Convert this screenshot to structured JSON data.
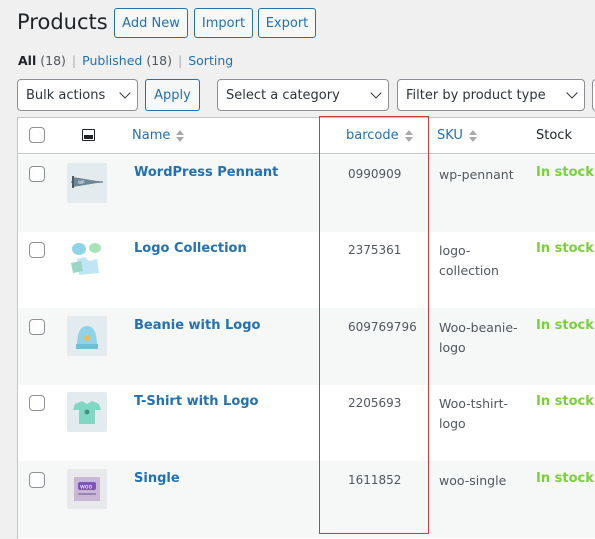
{
  "page": {
    "title": "Products",
    "buttons": {
      "add_new": "Add New",
      "import": "Import",
      "export": "Export"
    }
  },
  "filters": {
    "all_label": "All",
    "all_count": "(18)",
    "published_label": "Published",
    "published_count": "(18)",
    "sorting_label": "Sorting",
    "separator": "|"
  },
  "toolbar": {
    "bulk_actions": "Bulk actions",
    "apply": "Apply",
    "category": "Select a category",
    "product_type": "Filter by product type"
  },
  "table": {
    "columns": {
      "name": "Name",
      "barcode": "barcode",
      "sku": "SKU",
      "stock": "Stock"
    },
    "rows": [
      {
        "name": "WordPress Pennant",
        "barcode": "0990909",
        "sku": "wp-pennant",
        "stock": "In stock",
        "thumb": "pennant-icon"
      },
      {
        "name": "Logo Collection",
        "barcode": "2375361",
        "sku": "logo-collection",
        "stock": "In stock",
        "thumb": "clothing-collection-icon"
      },
      {
        "name": "Beanie with Logo",
        "barcode": "609769796",
        "sku": "Woo-beanie-logo",
        "stock": "In stock",
        "thumb": "beanie-icon"
      },
      {
        "name": "T-Shirt with Logo",
        "barcode": "2205693",
        "sku": "Woo-tshirt-logo",
        "stock": "In stock",
        "thumb": "tshirt-icon"
      },
      {
        "name": "Single",
        "barcode": "1611852",
        "sku": "woo-single",
        "stock": "In stock",
        "thumb": "album-icon"
      }
    ]
  },
  "colors": {
    "link": "#2271b1",
    "in_stock": "#7ad03a",
    "highlight": "#d63638"
  }
}
